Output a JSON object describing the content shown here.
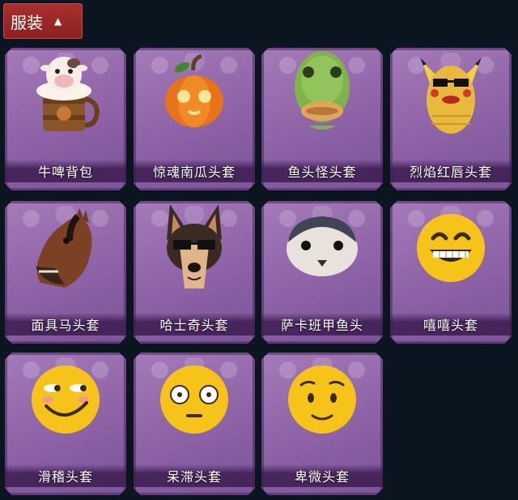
{
  "section": {
    "title": "服装",
    "toggle_icon": "chevron-up-icon"
  },
  "items": [
    {
      "name": "牛啤背包",
      "icon": "cow-beer-backpack-icon"
    },
    {
      "name": "惊魂南瓜头套",
      "icon": "pumpkin-head-icon"
    },
    {
      "name": "鱼头怪头套",
      "icon": "fish-head-icon"
    },
    {
      "name": "烈焰红唇头套",
      "icon": "yellow-mouse-mask-icon"
    },
    {
      "name": "面具马头套",
      "icon": "horse-mask-icon"
    },
    {
      "name": "哈士奇头套",
      "icon": "husky-head-icon"
    },
    {
      "name": "萨卡班甲鱼头",
      "icon": "sacabambaspis-head-icon"
    },
    {
      "name": "嘻嘻头套",
      "icon": "grin-emoji-icon"
    },
    {
      "name": "滑稽头套",
      "icon": "funny-emoji-icon"
    },
    {
      "name": "呆滞头套",
      "icon": "stunned-emoji-icon"
    },
    {
      "name": "卑微头套",
      "icon": "humble-emoji-icon"
    }
  ],
  "colors": {
    "background": "#0b1520",
    "card": "#9b72b4",
    "tab": "#a82f2d",
    "emoji": "#f6c419"
  }
}
